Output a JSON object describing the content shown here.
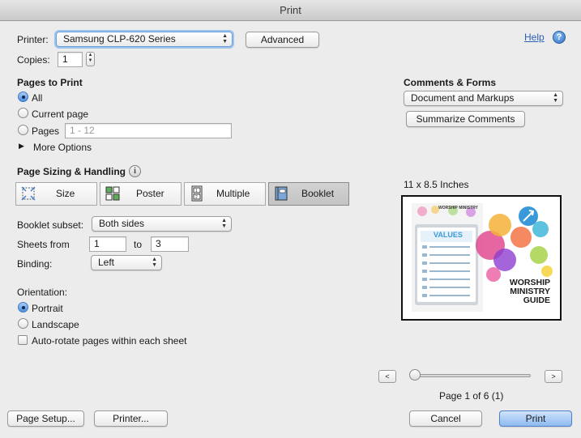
{
  "window": {
    "title": "Print"
  },
  "printer": {
    "label": "Printer:",
    "value": "Samsung CLP-620 Series",
    "advanced": "Advanced"
  },
  "help": {
    "label": "Help",
    "icon": "?"
  },
  "copies": {
    "label": "Copies:",
    "value": "1"
  },
  "pages": {
    "heading": "Pages to Print",
    "all": "All",
    "current": "Current page",
    "range_label": "Pages",
    "range_placeholder": "1 - 12",
    "more_options": "More Options"
  },
  "comments": {
    "heading": "Comments & Forms",
    "value": "Document and Markups",
    "summarize": "Summarize Comments"
  },
  "sizing": {
    "heading": "Page Sizing & Handling",
    "info_icon": "i",
    "tabs": [
      "Size",
      "Poster",
      "Multiple",
      "Booklet"
    ],
    "selected": "Booklet"
  },
  "booklet": {
    "subset_label": "Booklet subset:",
    "subset_value": "Both sides",
    "sheets_label": "Sheets from",
    "sheets_from": "1",
    "sheets_to_label": "to",
    "sheets_to": "3",
    "binding_label": "Binding:",
    "binding_value": "Left"
  },
  "orientation": {
    "heading": "Orientation:",
    "portrait": "Portrait",
    "landscape": "Landscape",
    "autorotate": "Auto-rotate pages within each sheet"
  },
  "preview": {
    "size_label": "11 x 8.5 Inches",
    "header_text": "WORSHIP MINISTRY",
    "values_text": "VALUES",
    "guide_line1": "WORSHIP",
    "guide_line2": "MINISTRY",
    "guide_line3": "GUIDE",
    "prev": "<",
    "next": ">",
    "page_status": "Page 1 of 6 (1)"
  },
  "footer": {
    "page_setup": "Page Setup...",
    "printer": "Printer...",
    "cancel": "Cancel",
    "print": "Print"
  },
  "colors": {
    "accent": "#2a5fb5",
    "preview_teal": "#3a9ad9",
    "preview_pink": "#d93a8c"
  }
}
